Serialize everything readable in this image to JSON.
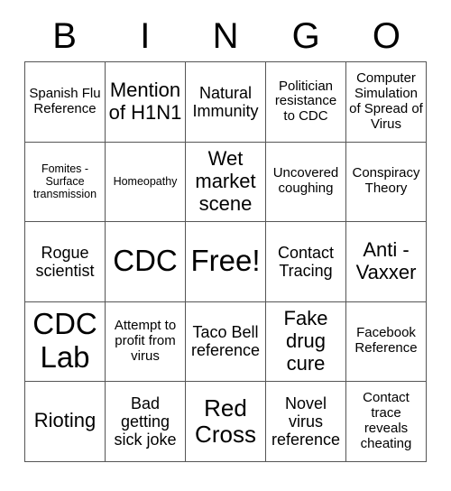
{
  "card": {
    "header_letters": [
      "B",
      "I",
      "N",
      "G",
      "O"
    ],
    "rows": [
      [
        {
          "text": "Spanish Flu Reference",
          "size": "s"
        },
        {
          "text": "Mention of H1N1",
          "size": "l"
        },
        {
          "text": "Natural Immunity",
          "size": "m"
        },
        {
          "text": "Politician resistance to CDC",
          "size": "s"
        },
        {
          "text": "Computer Simulation of Spread of Virus",
          "size": "s"
        }
      ],
      [
        {
          "text": "Fomites - Surface transmission",
          "size": "xs"
        },
        {
          "text": "Homeopathy",
          "size": "xs"
        },
        {
          "text": "Wet market scene",
          "size": "l"
        },
        {
          "text": "Uncovered coughing",
          "size": "s"
        },
        {
          "text": "Conspiracy Theory",
          "size": "s"
        }
      ],
      [
        {
          "text": "Rogue scientist",
          "size": "m"
        },
        {
          "text": "CDC",
          "size": "xxl"
        },
        {
          "text": "Free!",
          "size": "xxl"
        },
        {
          "text": "Contact Tracing",
          "size": "m"
        },
        {
          "text": "Anti - Vaxxer",
          "size": "l"
        }
      ],
      [
        {
          "text": "CDC Lab",
          "size": "xxl"
        },
        {
          "text": "Attempt to profit from virus",
          "size": "s"
        },
        {
          "text": "Taco Bell reference",
          "size": "m"
        },
        {
          "text": "Fake drug cure",
          "size": "l"
        },
        {
          "text": "Facebook Reference",
          "size": "s"
        }
      ],
      [
        {
          "text": "Rioting",
          "size": "l"
        },
        {
          "text": "Bad getting sick joke",
          "size": "m"
        },
        {
          "text": "Red Cross",
          "size": "xl"
        },
        {
          "text": "Novel virus reference",
          "size": "m"
        },
        {
          "text": "Contact trace reveals cheating",
          "size": "s"
        }
      ]
    ],
    "free_space_label": "Free!",
    "colors": {
      "background": "#ffffff",
      "text": "#000000",
      "grid_line": "#555555"
    }
  }
}
